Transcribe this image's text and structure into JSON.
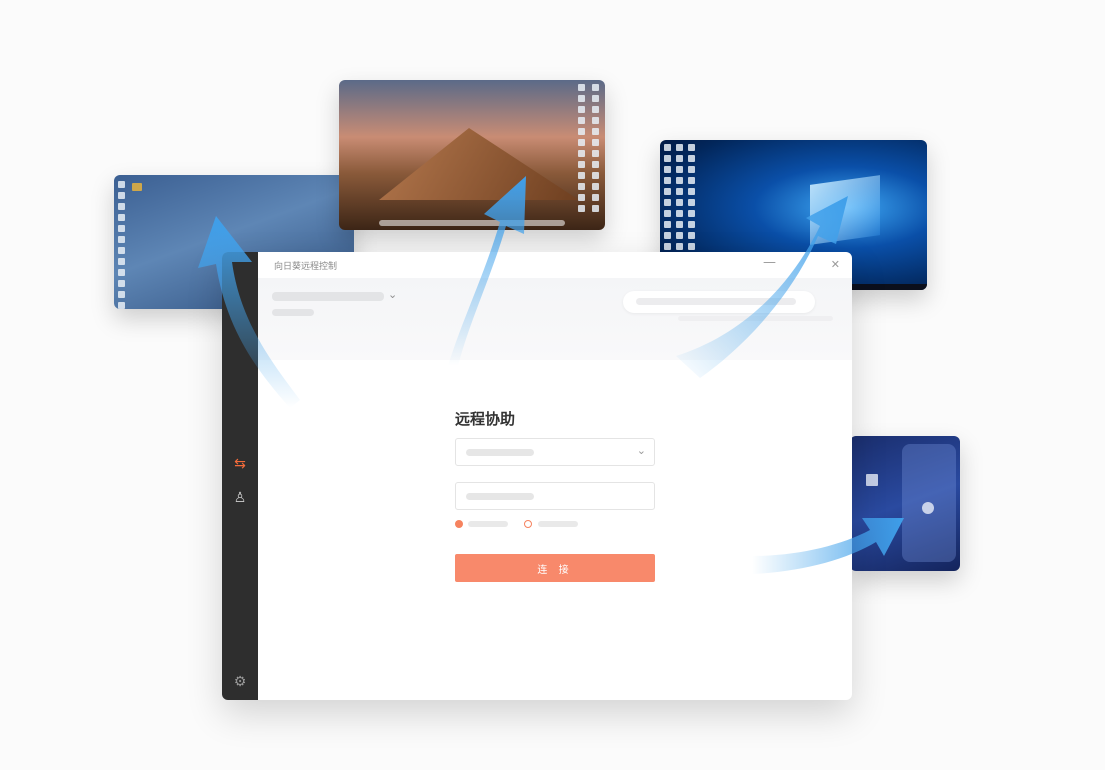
{
  "window": {
    "title": "向日葵远程控制",
    "minimize_icon": "minimize-icon",
    "close_icon": "close-icon"
  },
  "sidebar": {
    "items": [
      {
        "name": "remote-assist",
        "icon": "swap-arrows-icon",
        "active": true
      },
      {
        "name": "contacts",
        "icon": "contacts-icon",
        "active": false
      },
      {
        "name": "settings",
        "icon": "gear-icon",
        "active": false
      }
    ]
  },
  "form": {
    "title": "远程协助",
    "connect_label": "连 接"
  },
  "colors": {
    "accent": "#f8896b",
    "sidebar": "#2e2e2e",
    "arrow": "#4aa8ec"
  }
}
